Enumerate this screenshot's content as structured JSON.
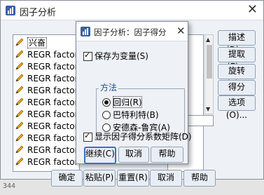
{
  "background": {
    "sheet_text": "344"
  },
  "outer_dialog": {
    "title": "因子分析",
    "close": "✕",
    "variables": [
      {
        "label": "兴奋"
      },
      {
        "label": "REGR factor sc"
      },
      {
        "label": "REGR factor sc"
      },
      {
        "label": "REGR factor sc"
      },
      {
        "label": "REGR factor sc"
      },
      {
        "label": "REGR factor sc"
      },
      {
        "label": "REGR factor sc"
      },
      {
        "label": "REGR factor sc"
      },
      {
        "label": "REGR factor sc"
      },
      {
        "label": "REGR factor sc"
      },
      {
        "label": "REGR factor sc"
      }
    ],
    "side_buttons": [
      "描述(D)...",
      "提取(E)...",
      "旋转(T)...",
      "得分(S)...",
      "选项(O)..."
    ],
    "bottom_buttons": [
      "确定",
      "粘贴(P)",
      "重置(R)",
      "取消",
      "帮助"
    ]
  },
  "inner_dialog": {
    "title": "因子分析：因子得分",
    "close": "✕",
    "save_as_variables": {
      "label": "保存为变量(S)",
      "checked": true
    },
    "method_group_label": "方法",
    "methods": [
      {
        "label": "回归(R)",
        "selected": true
      },
      {
        "label": "巴特利特(B)",
        "selected": false
      },
      {
        "label": "安德森-鲁宾(A)",
        "selected": false
      }
    ],
    "show_coef_matrix": {
      "label": "显示因子得分系数矩阵(D)",
      "checked": true
    },
    "buttons": [
      "继续(C)",
      "取消",
      "帮助"
    ]
  },
  "colors": {
    "accent": "#3c6fbf",
    "dialog_bg": "#eef1f6",
    "pencil": "#e0a21b"
  }
}
